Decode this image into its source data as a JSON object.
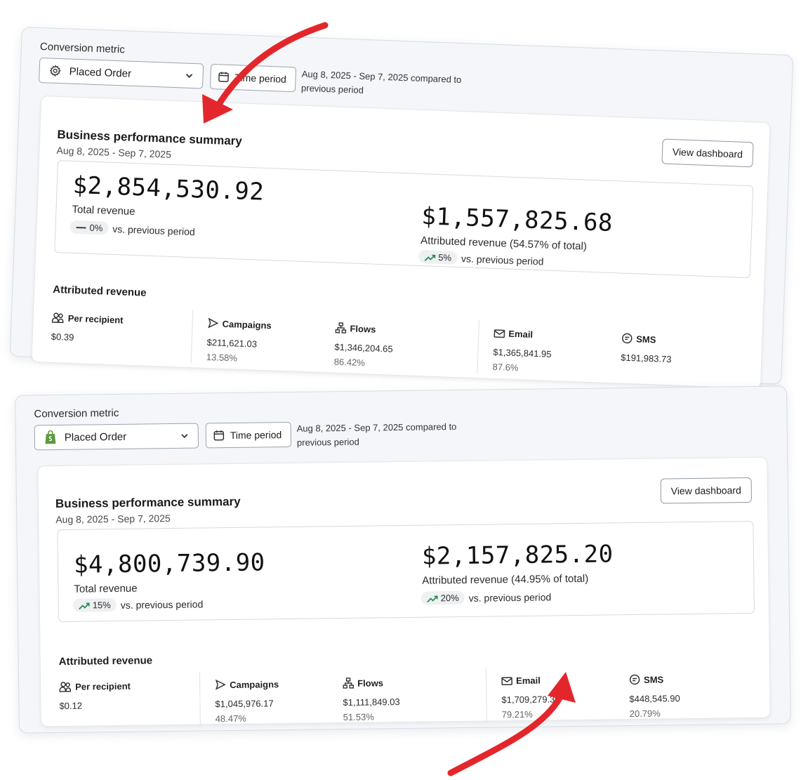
{
  "colors": {
    "arrow": "#e3262b",
    "trend_up": "#1f8a4c",
    "shopify_green": "#5c9a3a"
  },
  "panels": [
    {
      "metric_label": "Conversion metric",
      "select_icon": "gear-icon",
      "select_value": "Placed Order",
      "time_button": "Time period",
      "range_note": "Aug 8, 2025 - Sep 7, 2025 compared to previous period",
      "card": {
        "title": "Business performance summary",
        "subtitle": "Aug 8, 2025 - Sep 7, 2025",
        "view_button": "View dashboard",
        "total": {
          "value": "$2,854,530.92",
          "label": "Total revenue",
          "change": "0%",
          "trend": "flat",
          "suffix": "vs. previous period"
        },
        "attributed": {
          "value": "$1,557,825.68",
          "label": "Attributed revenue (54.57% of total)",
          "change": "5%",
          "trend": "up",
          "suffix": "vs. previous period"
        },
        "attr_title": "Attributed revenue",
        "metrics": [
          {
            "icon": "people-icon",
            "label": "Per recipient",
            "value": "$0.39",
            "pct": ""
          },
          {
            "icon": "send-icon",
            "label": "Campaigns",
            "value": "$211,621.03",
            "pct": "13.58%"
          },
          {
            "icon": "flows-icon",
            "label": "Flows",
            "value": "$1,346,204.65",
            "pct": "86.42%"
          },
          {
            "icon": "mail-icon",
            "label": "Email",
            "value": "$1,365,841.95",
            "pct": "87.6%"
          },
          {
            "icon": "sms-icon",
            "label": "SMS",
            "value": "$191,983.73",
            "pct": ""
          }
        ]
      }
    },
    {
      "metric_label": "Conversion metric",
      "select_icon": "shopify-bag-icon",
      "select_value": "Placed Order",
      "time_button": "Time period",
      "range_note": "Aug 8, 2025 - Sep 7, 2025 compared to previous period",
      "card": {
        "title": "Business performance summary",
        "subtitle": "Aug 8, 2025 - Sep 7, 2025",
        "view_button": "View dashboard",
        "total": {
          "value": "$4,800,739.90",
          "label": "Total revenue",
          "change": "15%",
          "trend": "up",
          "suffix": "vs. previous period"
        },
        "attributed": {
          "value": "$2,157,825.20",
          "label": "Attributed revenue (44.95% of total)",
          "change": "20%",
          "trend": "up",
          "suffix": "vs. previous period"
        },
        "attr_title": "Attributed revenue",
        "metrics": [
          {
            "icon": "people-icon",
            "label": "Per recipient",
            "value": "$0.12",
            "pct": ""
          },
          {
            "icon": "send-icon",
            "label": "Campaigns",
            "value": "$1,045,976.17",
            "pct": "48.47%"
          },
          {
            "icon": "flows-icon",
            "label": "Flows",
            "value": "$1,111,849.03",
            "pct": "51.53%"
          },
          {
            "icon": "mail-icon",
            "label": "Email",
            "value": "$1,709,279.30",
            "pct": "79.21%"
          },
          {
            "icon": "sms-icon",
            "label": "SMS",
            "value": "$448,545.90",
            "pct": "20.79%"
          }
        ]
      }
    }
  ]
}
